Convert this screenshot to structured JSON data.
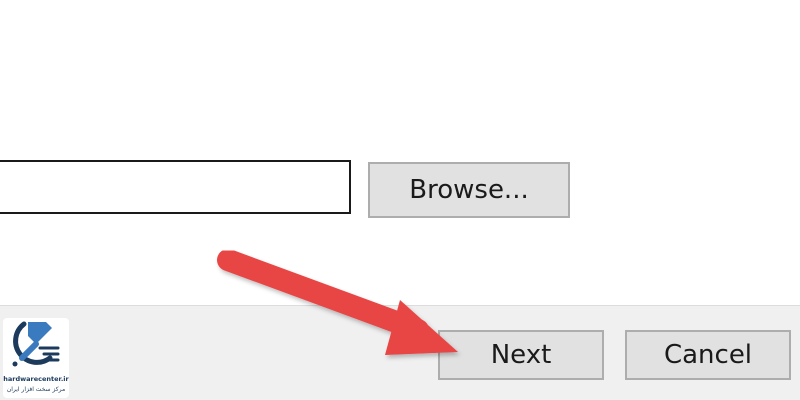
{
  "path_input": {
    "value": ""
  },
  "browse_button": {
    "label": "Browse..."
  },
  "footer": {
    "next_label": "Next",
    "cancel_label": "Cancel"
  },
  "logo": {
    "text_en": "hardwarecenter.ir",
    "text_fa": "مرکز سخت افزار ایران"
  },
  "colors": {
    "arrow": "#e84545",
    "button_face": "#e1e1e1",
    "footer_bg": "#f0f0f0",
    "logo_primary": "#1b3a5c"
  }
}
